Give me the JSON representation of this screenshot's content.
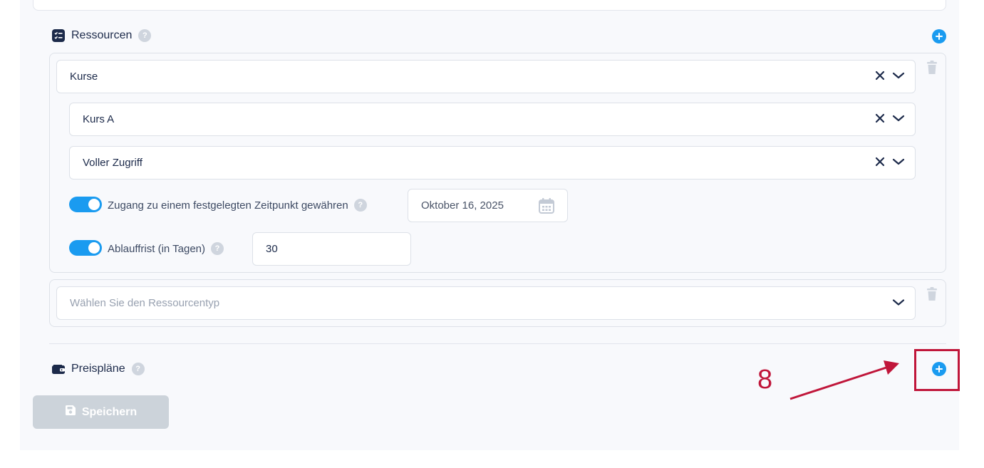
{
  "resources": {
    "title": "Ressourcen",
    "help": "?",
    "items": [
      {
        "type_value": "Kurse",
        "course_value": "Kurs A",
        "access_value": "Voller Zugriff",
        "timed_access_label": "Zugang zu einem festgelegten Zeitpunkt gewähren",
        "timed_access_date": "Oktober 16, 2025",
        "expiry_label": "Ablauffrist (in Tagen)",
        "expiry_days": "30"
      },
      {
        "type_placeholder": "Wählen Sie den Ressourcentyp"
      }
    ]
  },
  "pricing": {
    "title": "Preispläne",
    "help": "?"
  },
  "save_label": "Speichern",
  "annotation": {
    "number": "8",
    "color": "#c0163a"
  },
  "colors": {
    "accent": "#1a9bf0",
    "text": "#1c2a4a",
    "disabled": "#ccd3da"
  },
  "icons": {
    "resources": "checklist-icon",
    "pricing": "wallet-icon",
    "add": "plus-circle-icon",
    "delete": "trash-icon",
    "clear": "close-icon",
    "dropdown": "chevron-down-icon",
    "calendar": "calendar-icon",
    "save": "floppy-disk-icon"
  }
}
